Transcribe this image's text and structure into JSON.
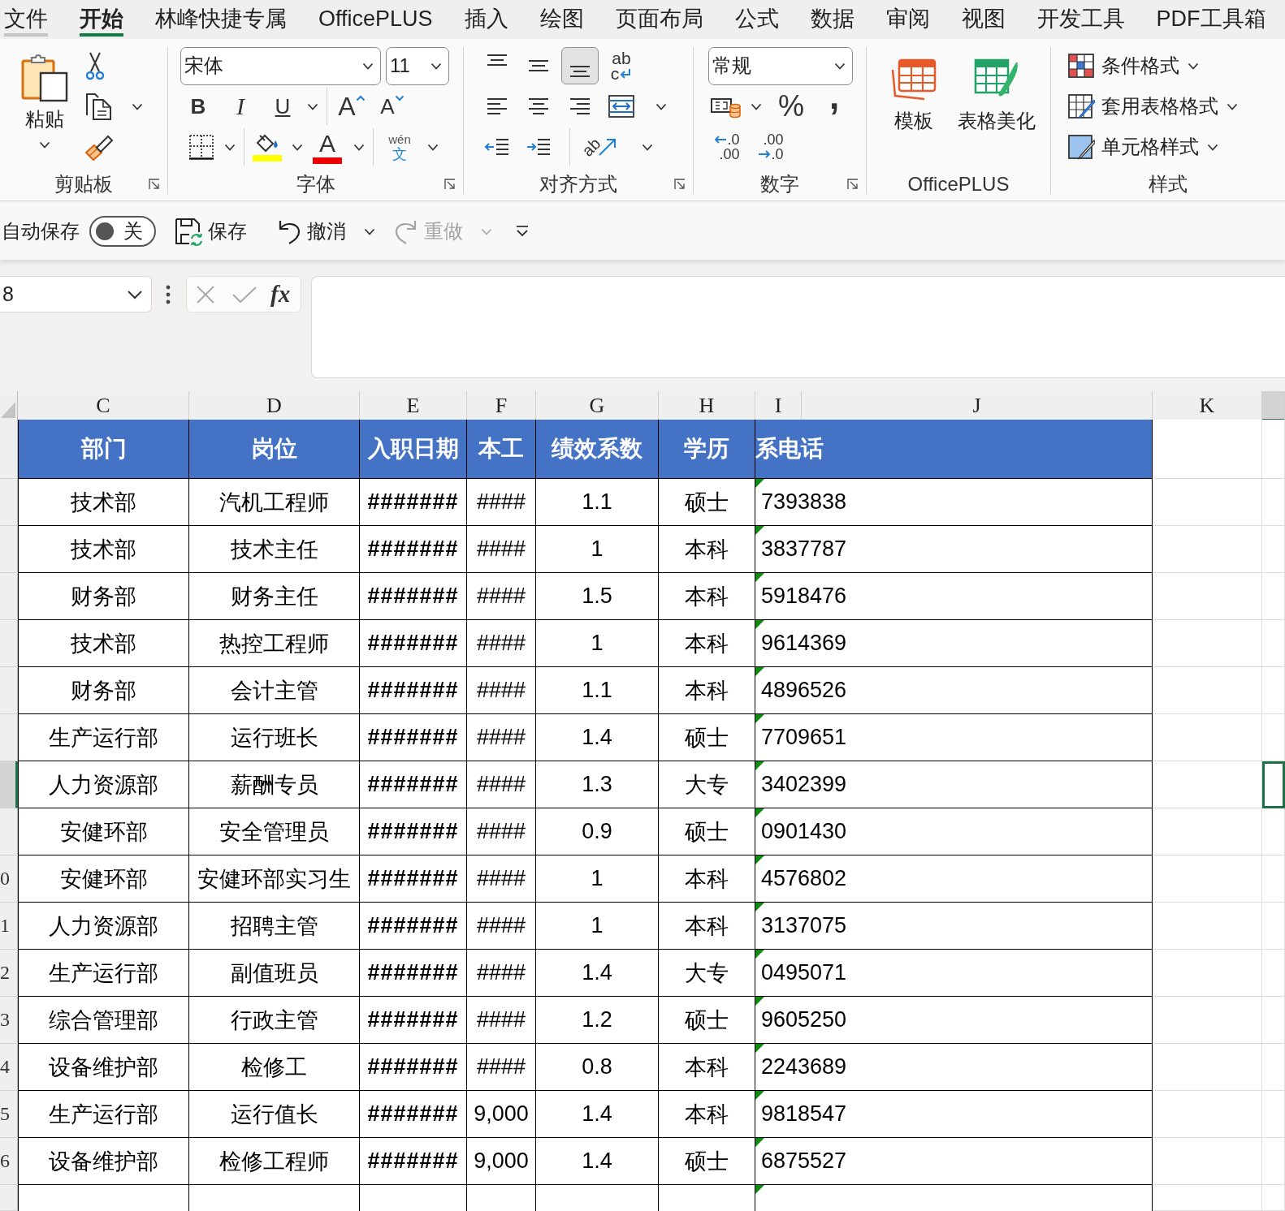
{
  "tabs": [
    {
      "label": "文件",
      "selected": false,
      "hovered": true
    },
    {
      "label": "开始",
      "selected": true,
      "hovered": false
    },
    {
      "label": "林峰快捷专属",
      "selected": false,
      "hovered": false
    },
    {
      "label": "OfficePLUS",
      "selected": false,
      "hovered": false
    },
    {
      "label": "插入",
      "selected": false,
      "hovered": false
    },
    {
      "label": "绘图",
      "selected": false,
      "hovered": false
    },
    {
      "label": "页面布局",
      "selected": false,
      "hovered": false
    },
    {
      "label": "公式",
      "selected": false,
      "hovered": false
    },
    {
      "label": "数据",
      "selected": false,
      "hovered": false
    },
    {
      "label": "审阅",
      "selected": false,
      "hovered": false
    },
    {
      "label": "视图",
      "selected": false,
      "hovered": false
    },
    {
      "label": "开发工具",
      "selected": false,
      "hovered": false
    },
    {
      "label": "PDF工具箱",
      "selected": false,
      "hovered": false
    }
  ],
  "ribbon": {
    "groups": [
      {
        "kind": "clipboard",
        "label": "剪贴板",
        "launcher": true,
        "paste": "粘贴"
      },
      {
        "kind": "font",
        "label": "字体",
        "launcher": true,
        "font_name": "宋体",
        "font_size": "11",
        "bold": "B",
        "italic": "I",
        "underline": "U",
        "grow": "A",
        "shrink": "A",
        "font_color": "A",
        "phonetic": {
          "top": "wén",
          "bottom": "文"
        }
      },
      {
        "kind": "alignment",
        "label": "对齐方式",
        "launcher": true,
        "vertical": [
          {
            "selected": false
          },
          {
            "selected": false
          },
          {
            "selected": true
          }
        ],
        "horizontal": [
          {
            "selected": false
          },
          {
            "selected": false
          },
          {
            "selected": false
          }
        ],
        "wrap": {
          "top": "ab",
          "bottom": "c"
        },
        "orientation": "ab"
      },
      {
        "kind": "number",
        "label": "数字",
        "launcher": true,
        "format": "常规",
        "percent": "%",
        "comma": ",",
        "increase_decimal": {
          "top": ".0",
          "bottom": ".00"
        },
        "decrease_decimal": {
          "top": ".00",
          "bottom": ".0"
        }
      },
      {
        "kind": "officeplus",
        "label": "OfficePLUS",
        "launcher": false,
        "buttons": [
          {
            "kind": "template",
            "label": "模板"
          },
          {
            "kind": "beautify",
            "label": "表格美化"
          }
        ]
      },
      {
        "kind": "styles",
        "label": "样式",
        "launcher": false,
        "buttons": [
          {
            "kind": "conditional",
            "label": "条件格式"
          },
          {
            "kind": "table",
            "label": "套用表格格式"
          },
          {
            "kind": "cell",
            "label": "单元格样式"
          }
        ]
      }
    ]
  },
  "quick_access": {
    "autosave": {
      "label": "自动保存",
      "on": false,
      "state_label": "关"
    },
    "commands": [
      {
        "kind": "save",
        "label": "保存",
        "disabled": false,
        "dropdown": false
      },
      {
        "kind": "undo",
        "label": "撤消",
        "disabled": false,
        "dropdown": true
      },
      {
        "kind": "redo",
        "label": "重做",
        "disabled": true,
        "dropdown": true
      }
    ]
  },
  "formula_bar": {
    "name_box": "8",
    "function_label": "fx"
  },
  "sheet": {
    "columns": [
      {
        "label": "C",
        "selected": false
      },
      {
        "label": "D",
        "selected": false
      },
      {
        "label": "E",
        "selected": false
      },
      {
        "label": "F",
        "selected": false
      },
      {
        "label": "G",
        "selected": false
      },
      {
        "label": "H",
        "selected": false
      },
      {
        "label": "I",
        "selected": false
      },
      {
        "label": "J",
        "selected": false
      },
      {
        "label": "K",
        "selected": false
      },
      {
        "selected": true
      }
    ],
    "header": [
      "部门",
      "岗位",
      "入职日期",
      "本工",
      "绩效系数",
      "学历",
      "系电话"
    ],
    "rows": [
      {
        "selected": false,
        "flagged": true,
        "cells": [
          "技术部",
          "汽机工程师",
          "#######",
          "####",
          "1.1",
          "硕士",
          "7393838"
        ]
      },
      {
        "selected": false,
        "flagged": true,
        "cells": [
          "技术部",
          "技术主任",
          "#######",
          "####",
          "1",
          "本科",
          "3837787"
        ]
      },
      {
        "selected": false,
        "flagged": true,
        "cells": [
          "财务部",
          "财务主任",
          "#######",
          "####",
          "1.5",
          "本科",
          "5918476"
        ]
      },
      {
        "selected": false,
        "flagged": true,
        "cells": [
          "技术部",
          "热控工程师",
          "#######",
          "####",
          "1",
          "本科",
          "9614369"
        ]
      },
      {
        "selected": false,
        "flagged": true,
        "cells": [
          "财务部",
          "会计主管",
          "#######",
          "####",
          "1.1",
          "本科",
          "4896526"
        ]
      },
      {
        "selected": false,
        "flagged": true,
        "cells": [
          "生产运行部",
          "运行班长",
          "#######",
          "####",
          "1.4",
          "硕士",
          "7709651"
        ]
      },
      {
        "selected": true,
        "flagged": true,
        "cells": [
          "人力资源部",
          "薪酬专员",
          "#######",
          "####",
          "1.3",
          "大专",
          "3402399"
        ]
      },
      {
        "selected": false,
        "flagged": true,
        "cells": [
          "安健环部",
          "安全管理员",
          "#######",
          "####",
          "0.9",
          "硕士",
          "0901430"
        ]
      },
      {
        "row_label": "0",
        "selected": false,
        "flagged": true,
        "cells": [
          "安健环部",
          "安健环部实习生",
          "#######",
          "####",
          "1",
          "本科",
          "4576802"
        ]
      },
      {
        "row_label": "1",
        "selected": false,
        "flagged": true,
        "cells": [
          "人力资源部",
          "招聘主管",
          "#######",
          "####",
          "1",
          "本科",
          "3137075"
        ]
      },
      {
        "row_label": "2",
        "selected": false,
        "flagged": true,
        "cells": [
          "生产运行部",
          "副值班员",
          "#######",
          "####",
          "1.4",
          "大专",
          "0495071"
        ]
      },
      {
        "row_label": "3",
        "selected": false,
        "flagged": true,
        "cells": [
          "综合管理部",
          "行政主管",
          "#######",
          "####",
          "1.2",
          "硕士",
          "9605250"
        ]
      },
      {
        "row_label": "4",
        "selected": false,
        "flagged": true,
        "cells": [
          "设备维护部",
          "检修工",
          "#######",
          "####",
          "0.8",
          "本科",
          "2243689"
        ]
      },
      {
        "row_label": "5",
        "selected": false,
        "flagged": true,
        "cells": [
          "生产运行部",
          "运行值长",
          "#######",
          "9,000",
          "1.4",
          "本科",
          "9818547"
        ]
      },
      {
        "row_label": "6",
        "selected": false,
        "flagged": true,
        "cells": [
          "设备维护部",
          "检修工程师",
          "#######",
          "9,000",
          "1.4",
          "硕士",
          "6875527"
        ]
      }
    ],
    "cut_row": {
      "flagged": true
    }
  }
}
